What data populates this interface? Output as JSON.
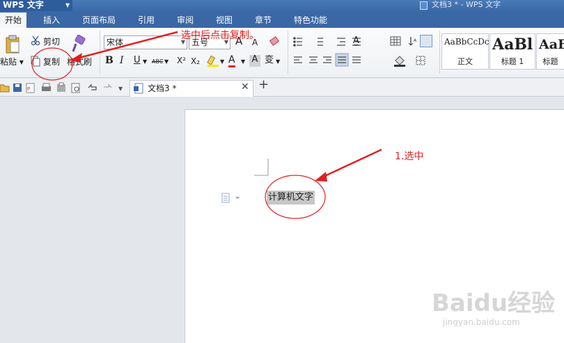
{
  "app": {
    "menu_label": "WPS 文字",
    "window_title": "文档3 * - WPS 文字"
  },
  "tabs": [
    "开始",
    "插入",
    "页面布局",
    "引用",
    "审阅",
    "视图",
    "章节",
    "特色功能"
  ],
  "clipboard": {
    "paste": "粘贴",
    "cut": "剪切",
    "copy": "复制",
    "format_painter": "格式刷"
  },
  "font": {
    "name": "宋体",
    "size": "五号",
    "bold": "B",
    "italic": "I",
    "underline": "U",
    "strike": "ABC",
    "superscript": "X²",
    "subscript": "X₂",
    "color_a": "A",
    "phonetic": "变"
  },
  "styles": [
    {
      "preview": "AaBbCcDc",
      "label": "正文"
    },
    {
      "preview": "AaBl",
      "label": "标题 1"
    },
    {
      "preview": "AaB",
      "label": "标题"
    }
  ],
  "document": {
    "tab_title": "文档3 *",
    "selected_text": "计算机文字"
  },
  "annotations": {
    "step1": "1.选中",
    "step2": "选中后点击复制。"
  },
  "watermark": {
    "main": "Baidu经验",
    "sub": "jingyan.baidu.com"
  },
  "colors": {
    "accent": "#3a67a6",
    "annotation": "#e02020",
    "highlight": "#c7c7c7"
  }
}
